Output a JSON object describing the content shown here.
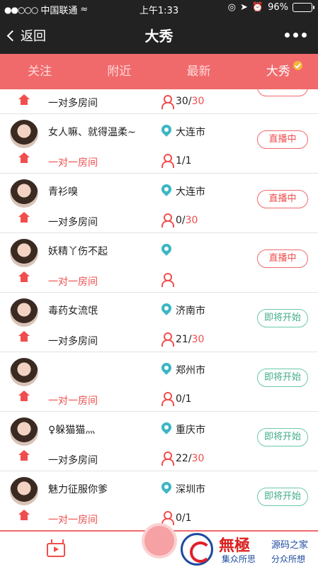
{
  "status_bar": {
    "carrier": "中国联通",
    "time": "上午1:33",
    "battery": "96%",
    "battery_level": 0.96
  },
  "nav": {
    "back_label": "返回",
    "title": "大秀"
  },
  "tabs": [
    {
      "label": "关注",
      "active": false
    },
    {
      "label": "附近",
      "active": false
    },
    {
      "label": "最新",
      "active": false
    },
    {
      "label": "大秀",
      "active": true
    }
  ],
  "partial_row": {
    "room": "一对多房间",
    "count": "30",
    "max": "30"
  },
  "rows": [
    {
      "nickname": "女人嘛、就得温柔~",
      "city": "大连市",
      "room": "一对一房间",
      "room_red": true,
      "count": "1",
      "max": "1",
      "max_red": false,
      "status": "直播中",
      "status_type": "live"
    },
    {
      "nickname": "青衫嗅",
      "city": "大连市",
      "room": "一对多房间",
      "room_red": false,
      "count": "0",
      "max": "30",
      "max_red": true,
      "status": "直播中",
      "status_type": "live"
    },
    {
      "nickname": "妖精丫伤不起",
      "city": "",
      "room": "一对一房间",
      "room_red": true,
      "count": "",
      "max": "",
      "max_red": false,
      "status": "直播中",
      "status_type": "live"
    },
    {
      "nickname": "毒药女流氓",
      "city": "济南市",
      "room": "一对多房间",
      "room_red": false,
      "count": "21",
      "max": "30",
      "max_red": true,
      "status": "即将开始",
      "status_type": "soon"
    },
    {
      "nickname": "",
      "city": "郑州市",
      "room": "一对一房间",
      "room_red": true,
      "count": "0",
      "max": "1",
      "max_red": false,
      "status": "即将开始",
      "status_type": "soon"
    },
    {
      "nickname": "♀躲猫猫灬",
      "city": "重庆市",
      "room": "一对多房间",
      "room_red": false,
      "count": "22",
      "max": "30",
      "max_red": true,
      "status": "即将开始",
      "status_type": "soon"
    },
    {
      "nickname": "魅力征服你爹",
      "city": "深圳市",
      "room": "一对一房间",
      "room_red": true,
      "count": "0",
      "max": "1",
      "max_red": false,
      "status": "即将开始",
      "status_type": "soon"
    }
  ],
  "watermark": {
    "big": "無極",
    "sub1": "源码之家",
    "sub2": "集众所思",
    "sub3": "分众所想"
  }
}
